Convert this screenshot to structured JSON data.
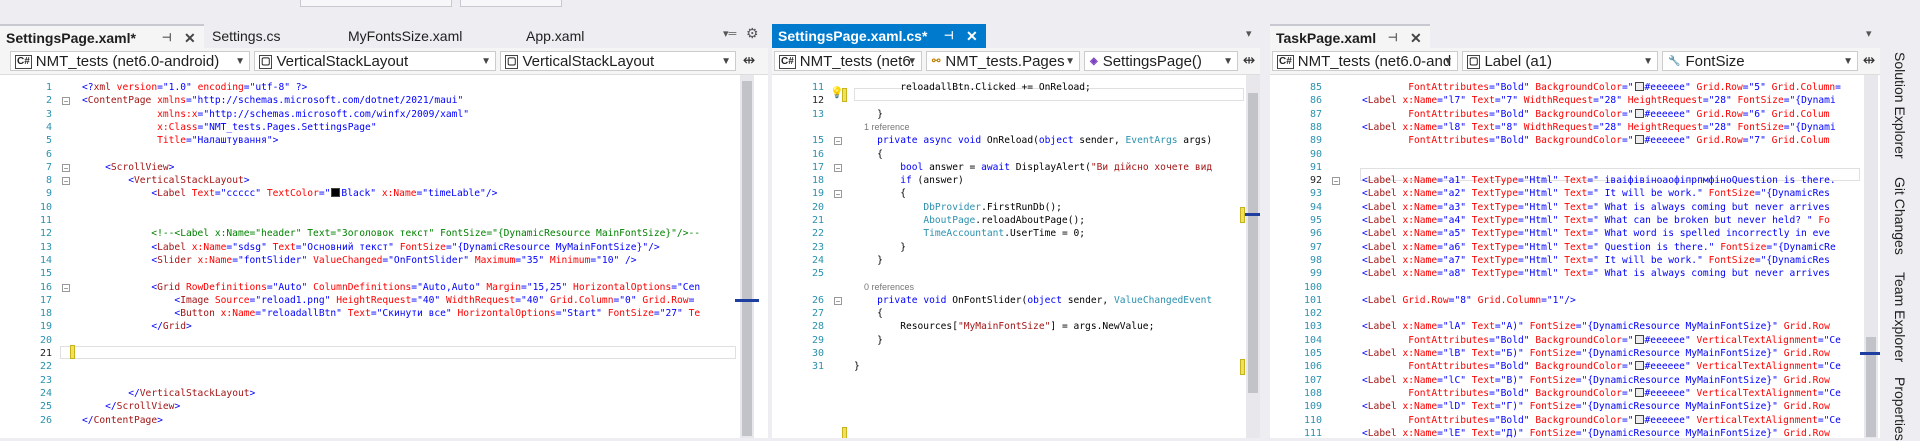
{
  "panes": [
    {
      "tabs": [
        {
          "label": "SettingsPage.xaml*",
          "active": true
        },
        {
          "label": "Settings.cs"
        },
        {
          "label": "MyFontsSize.xaml"
        },
        {
          "label": "App.xaml"
        }
      ],
      "nav": [
        "NMT_tests (net6.0-android)",
        "VerticalStackLayout",
        "VerticalStackLayout"
      ],
      "lines": [
        "1",
        "2",
        "3",
        "4",
        "5",
        "6",
        "7",
        "8",
        "9",
        "10",
        "11",
        "12",
        "13",
        "14",
        "15",
        "16",
        "17",
        "18",
        "19",
        "20",
        "21",
        "22",
        "23",
        "24",
        "25",
        "26"
      ]
    },
    {
      "tabs": [
        {
          "label": "SettingsPage.xaml.cs*",
          "active": true
        }
      ],
      "nav": [
        "NMT_tests (net6.",
        "NMT_tests.Pages",
        "SettingsPage()"
      ],
      "lines": [
        "11",
        "12",
        "13",
        "",
        "15",
        "16",
        "17",
        "18",
        "19",
        "20",
        "21",
        "22",
        "23",
        "24",
        "25",
        "",
        "26",
        "27",
        "28",
        "29",
        "30",
        "31"
      ]
    },
    {
      "tabs": [
        {
          "label": "TaskPage.xaml",
          "active": true
        }
      ],
      "nav": [
        "NMT_tests (net6.0-and",
        "Label (a1)",
        "FontSize"
      ],
      "lines": [
        "85",
        "86",
        "87",
        "88",
        "89",
        "90",
        "91",
        "92",
        "93",
        "94",
        "95",
        "96",
        "97",
        "98",
        "99",
        "100",
        "101",
        "102",
        "103",
        "104",
        "105",
        "106",
        "107",
        "108",
        "109",
        "110",
        "111"
      ]
    }
  ],
  "code": {
    "p1": [
      "<?xml version=\"1.0\" encoding=\"utf-8\" ?>",
      "<ContentPage xmlns=\"http://schemas.microsoft.com/dotnet/2021/maui\"",
      "             xmlns:x=\"http://schemas.microsoft.com/winfx/2009/xaml\"",
      "             x:Class=\"NMT_tests.Pages.SettingsPage\"",
      "             Title=\"Налаштування\">",
      "",
      "    <ScrollView>",
      "        <VerticalStackLayout>",
      "            <Label Text=\"ccccc\" TextColor=\"Black\" x:Name=\"timeLable\"/>",
      "",
      "",
      "            <!--<Label x:Name=\"header\" Text=\"Зоголовок текст\" FontSize=\"{DynamicResource MainFontSize}\"/>--",
      "            <Label x:Name=\"sdsg\" Text=\"Основний текст\" FontSize=\"{DynamicResource MyMainFontSize}\"/>",
      "            <Slider x:Name=\"fontSlider\" ValueChanged=\"OnFontSlider\" Maximum=\"35\" Minimum=\"10\" />",
      "",
      "            <Grid RowDefinitions=\"Auto\" ColumnDefinitions=\"Auto,Auto\" Margin=\"15,25\" HorizontalOptions=\"Cen",
      "                <Image Source=\"reload1.png\" HeightRequest=\"40\" WidthRequest=\"40\" Grid.Column=\"0\" Grid.Row=",
      "                <Button x:Name=\"reloadallBtn\" Text=\"Скинути все\" HorizontalOptions=\"Start\" FontSize=\"27\" Te",
      "            </Grid>",
      "",
      "",
      "",
      "",
      "        </VerticalStackLayout>",
      "    </ScrollView>",
      "</ContentPage>"
    ],
    "p2": [
      "        reloadallBtn.Clicked += OnReload;",
      "",
      "    }",
      "    1 reference",
      "    private async void OnReload(object sender, EventArgs args)",
      "    {",
      "        bool answer = await DisplayAlert(\"Ви дійсно хочете вид",
      "        if (answer)",
      "        {",
      "            DbProvider.FirstRunDb();",
      "            AboutPage.reloadAboutPage();",
      "            TimeAccountant.UserTime = 0;",
      "        }",
      "    }",
      "",
      "    0 references",
      "    private void OnFontSlider(object sender, ValueChangedEvent",
      "    {",
      "        Resources[\"MyMainFontSize\"] = args.NewValue;",
      "    }",
      "",
      "}"
    ],
    "p3": [
      "        FontAttributes=\"Bold\" BackgroundColor=\"#eeeeee\" Grid.Row=\"5\" Grid.Column=",
      "<Label x:Name=\"l7\" Text=\"7\" WidthRequest=\"28\" HeightRequest=\"28\" FontSize=\"{Dynami",
      "        FontAttributes=\"Bold\" BackgroundColor=\"#eeeeee\" Grid.Row=\"6\" Grid.Colum",
      "<Label x:Name=\"l8\" Text=\"8\" WidthRequest=\"28\" HeightRequest=\"28\" FontSize=\"{Dynami",
      "        FontAttributes=\"Bold\" BackgroundColor=\"#eeeeee\" Grid.Row=\"7\" Grid.Colum",
      "",
      "",
      "<Label x:Name=\"a1\" TextType=\"Html\" Text=\" іваіфівіноаофіпрпмфіноQuestion is there.",
      "<Label x:Name=\"a2\" TextType=\"Html\" Text=\" It will be work.\" FontSize=\"{DynamicRes",
      "<Label x:Name=\"a3\" TextType=\"Html\" Text=\" What is always coming but never arrives",
      "<Label x:Name=\"a4\" TextType=\"Html\" Text=\" What can be broken but never held? \" Fo",
      "<Label x:Name=\"a5\" TextType=\"Html\" Text=\" What word is spelled incorrectly in eve",
      "<Label x:Name=\"a6\" TextType=\"Html\" Text=\" Question is there.\" FontSize=\"{DynamicRe",
      "<Label x:Name=\"a7\" TextType=\"Html\" Text=\" It will be work.\" FontSize=\"{DynamicRes",
      "<Label x:Name=\"a8\" TextType=\"Html\" Text=\" What is always coming but never arrives",
      "",
      "<Label Grid.Row=\"8\" Grid.Column=\"1\"/>",
      "",
      "<Label x:Name=\"lA\" Text=\"A)\" FontSize=\"{DynamicResource MyMainFontSize}\" Grid.Row",
      "        FontAttributes=\"Bold\" BackgroundColor=\"#eeeeee\" VerticalTextAlignment=\"Ce",
      "<Label x:Name=\"lB\" Text=\"Б)\" FontSize=\"{DynamicResource MyMainFontSize}\" Grid.Row",
      "        FontAttributes=\"Bold\" BackgroundColor=\"#eeeeee\" VerticalTextAlignment=\"Ce",
      "<Label x:Name=\"lC\" Text=\"В)\" FontSize=\"{DynamicResource MyMainFontSize}\" Grid.Row",
      "        FontAttributes=\"Bold\" BackgroundColor=\"#eeeeee\" VerticalTextAlignment=\"Ce",
      "<Label x:Name=\"lD\" Text=\"Г)\" FontSize=\"{DynamicResource MyMainFontSize}\" Grid.Row",
      "        FontAttributes=\"Bold\" BackgroundColor=\"#eeeeee\" VerticalTextAlignment=\"Ce",
      "<Label x:Name=\"lE\" Text=\"Д)\" FontSize=\"{DynamicResource MyMainFontSize}\" Grid.Row"
    ]
  },
  "sidebar": [
    "Solution Explorer",
    "Git Changes",
    "Team Explorer",
    "Properties"
  ],
  "colors": {
    "accent": "#007acc",
    "marker": "#1e3fa0",
    "line_number": "#2b91af"
  }
}
